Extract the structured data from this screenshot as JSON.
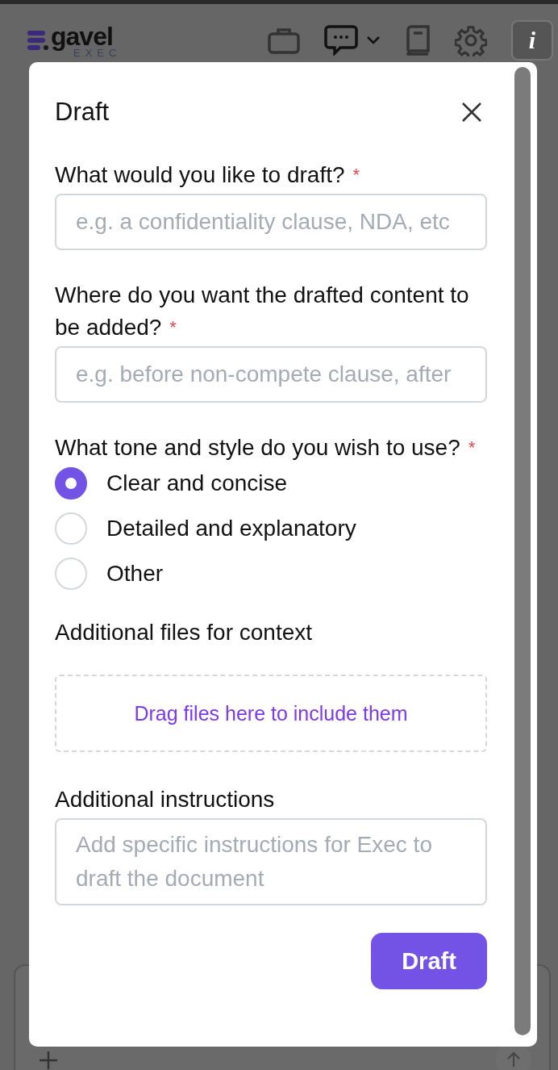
{
  "header": {
    "logo": {
      "wordmark": "gavel",
      "tagline": "EXEC"
    },
    "info_button": "i"
  },
  "dialog": {
    "title": "Draft",
    "fields": [
      {
        "kind": "text",
        "label": "What would you like to draft?",
        "required_mark": "*",
        "placeholder": "e.g. a confidentiality clause, NDA, etc"
      },
      {
        "kind": "text",
        "label": "Where do you want the drafted content to be added?",
        "required_mark": "*",
        "placeholder": "e.g. before non-compete clause, after"
      },
      {
        "kind": "radio",
        "label": "What tone and style do you wish to use?",
        "required_mark": "*",
        "options": [
          {
            "label": "Clear and concise",
            "selected": true
          },
          {
            "label": "Detailed and explanatory",
            "selected": false
          },
          {
            "label": "Other",
            "selected": false
          }
        ]
      },
      {
        "kind": "dropzone",
        "label": "Additional files for context",
        "prompt": "Drag files here to include them"
      },
      {
        "kind": "textarea",
        "label": "Additional instructions",
        "placeholder": "Add specific instructions for Exec to draft the document"
      }
    ],
    "submit": "Draft"
  }
}
